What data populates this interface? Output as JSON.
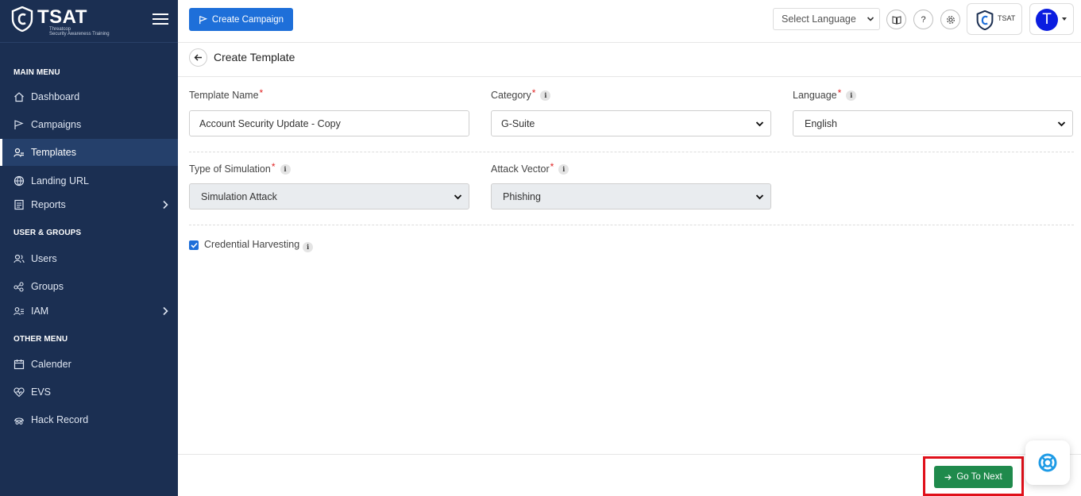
{
  "brand": {
    "title": "TSAT",
    "subtitle_line1": "Threatcop",
    "subtitle_line2": "Security Awareness Training"
  },
  "sidebar": {
    "sections": [
      {
        "label": "MAIN MENU"
      },
      {
        "label": "USER & GROUPS"
      },
      {
        "label": "OTHER MENU"
      }
    ],
    "items": [
      {
        "label": "Dashboard",
        "icon": "home-icon"
      },
      {
        "label": "Campaigns",
        "icon": "campaign-flag-icon"
      },
      {
        "label": "Templates",
        "icon": "templates-icon",
        "active": true
      },
      {
        "label": "Landing URL",
        "icon": "globe-icon"
      },
      {
        "label": "Reports",
        "icon": "report-icon",
        "has_submenu": true
      },
      {
        "label": "Users",
        "icon": "users-icon"
      },
      {
        "label": "Groups",
        "icon": "groups-icon"
      },
      {
        "label": "IAM",
        "icon": "iam-icon",
        "has_submenu": true
      },
      {
        "label": "Calender",
        "icon": "calendar-icon"
      },
      {
        "label": "EVS",
        "icon": "heart-pulse-icon"
      },
      {
        "label": "Hack Record",
        "icon": "hack-record-icon"
      }
    ]
  },
  "topbar": {
    "create_campaign_label": "Create Campaign",
    "language_select_value": "Select Language",
    "help_label": "?",
    "tsat_badge_label": "TSAT",
    "avatar_initial": "T"
  },
  "page": {
    "title": "Create Template"
  },
  "form": {
    "template_name": {
      "label": "Template Name",
      "required": "*",
      "value": "Account Security Update - Copy"
    },
    "category": {
      "label": "Category",
      "required": "*",
      "info": "i",
      "value": "G-Suite"
    },
    "language": {
      "label": "Language",
      "required": "*",
      "info": "i",
      "value": "English"
    },
    "type_of_simulation": {
      "label": "Type of Simulation",
      "required": "*",
      "info": "i",
      "value": "Simulation Attack"
    },
    "attack_vector": {
      "label": "Attack Vector",
      "required": "*",
      "info": "i",
      "value": "Phishing"
    },
    "credential_harvesting": {
      "label": "Credential Harvesting",
      "info": "i",
      "checked": true
    }
  },
  "footer": {
    "next_label": "Go To Next"
  },
  "colors": {
    "sidebar_bg": "#1b2f52",
    "primary_blue": "#1e6fd9",
    "next_green": "#1f8a4c",
    "highlight_red": "#e0101a",
    "avatar_blue": "#0b1de0"
  }
}
